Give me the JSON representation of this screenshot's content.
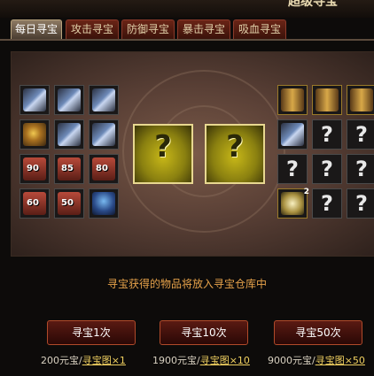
{
  "header": {
    "title": "超级寻宝"
  },
  "tabs": [
    {
      "label": "每日寻宝",
      "active": true
    },
    {
      "label": "攻击寻宝",
      "active": false
    },
    {
      "label": "防御寻宝",
      "active": false
    },
    {
      "label": "暴击寻宝",
      "active": false
    },
    {
      "label": "吸血寻宝",
      "active": false
    }
  ],
  "left_grid": [
    {
      "icon": "weapon"
    },
    {
      "icon": "weapon"
    },
    {
      "icon": "weapon"
    },
    {
      "icon": "armor"
    },
    {
      "icon": "weapon"
    },
    {
      "icon": "weapon"
    },
    {
      "icon": "chest",
      "label": "90"
    },
    {
      "icon": "chest",
      "label": "85"
    },
    {
      "icon": "chest",
      "label": "80"
    },
    {
      "icon": "chest",
      "label": "60"
    },
    {
      "icon": "chest",
      "label": "50"
    },
    {
      "icon": "bag"
    }
  ],
  "right_grid": [
    {
      "icon": "belt"
    },
    {
      "icon": "belt"
    },
    {
      "icon": "belt"
    },
    {
      "icon": "weapon"
    },
    {
      "icon": "question"
    },
    {
      "icon": "question"
    },
    {
      "icon": "question"
    },
    {
      "icon": "question"
    },
    {
      "icon": "question"
    },
    {
      "icon": "gem",
      "badge": "2"
    },
    {
      "icon": "question"
    },
    {
      "icon": "question"
    }
  ],
  "center_slots": [
    "?",
    "?"
  ],
  "notice": "寻宝获得的物品将放入寻宝仓库中",
  "buttons": [
    {
      "label": "寻宝1次",
      "cost_prefix": "200元宝/",
      "cost_link": "寻宝图×1"
    },
    {
      "label": "寻宝10次",
      "cost_prefix": "1900元宝/",
      "cost_link": "寻宝图×10"
    },
    {
      "label": "寻宝50次",
      "cost_prefix": "9000元宝/",
      "cost_link": "寻宝图×50"
    }
  ],
  "colors": {
    "notice": "#e6a24a",
    "link": "#f0d060",
    "question_slot": "#c8b818"
  }
}
